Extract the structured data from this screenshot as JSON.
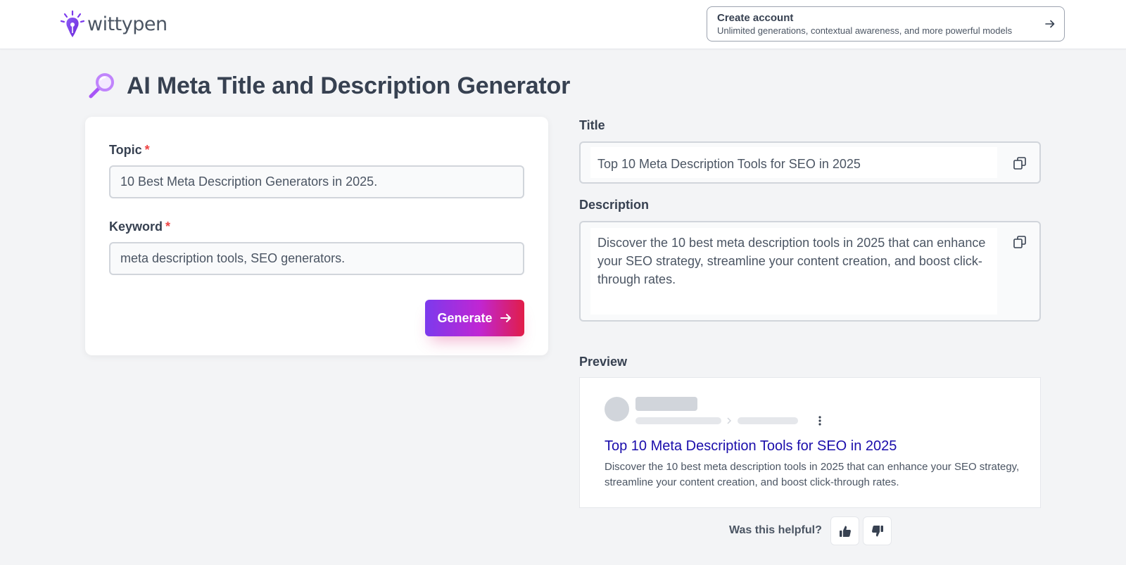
{
  "header": {
    "logo_text": "wittypen",
    "create_account": {
      "title": "Create account",
      "subtitle": "Unlimited generations, contextual awareness, and more powerful models"
    }
  },
  "page": {
    "title": "AI Meta Title and Description Generator",
    "title_icon": "magnifying-glass-icon"
  },
  "form": {
    "topic_label": "Topic",
    "topic_value": "10 Best Meta Description Generators in 2025.",
    "keyword_label": "Keyword",
    "keyword_value": "meta description tools, SEO generators.",
    "required_mark": "*",
    "generate_label": "Generate"
  },
  "output": {
    "title_label": "Title",
    "title_value": "Top 10 Meta Description Tools for SEO in 2025",
    "description_label": "Description",
    "description_value": "Discover the 10 best meta description tools in 2025 that can enhance your SEO strategy, streamline your content creation, and boost click-through rates."
  },
  "preview": {
    "label": "Preview",
    "title": "Top 10 Meta Description Tools for SEO in 2025",
    "description": "Discover the 10 best meta description tools in 2025 that can enhance your SEO strategy, streamline your content creation, and boost click-through rates."
  },
  "feedback": {
    "question": "Was this helpful?"
  },
  "colors": {
    "accent_purple": "#7c3aed",
    "accent_pink": "#e11d48",
    "link_blue": "#1a0dab",
    "required_red": "#ef4444"
  }
}
